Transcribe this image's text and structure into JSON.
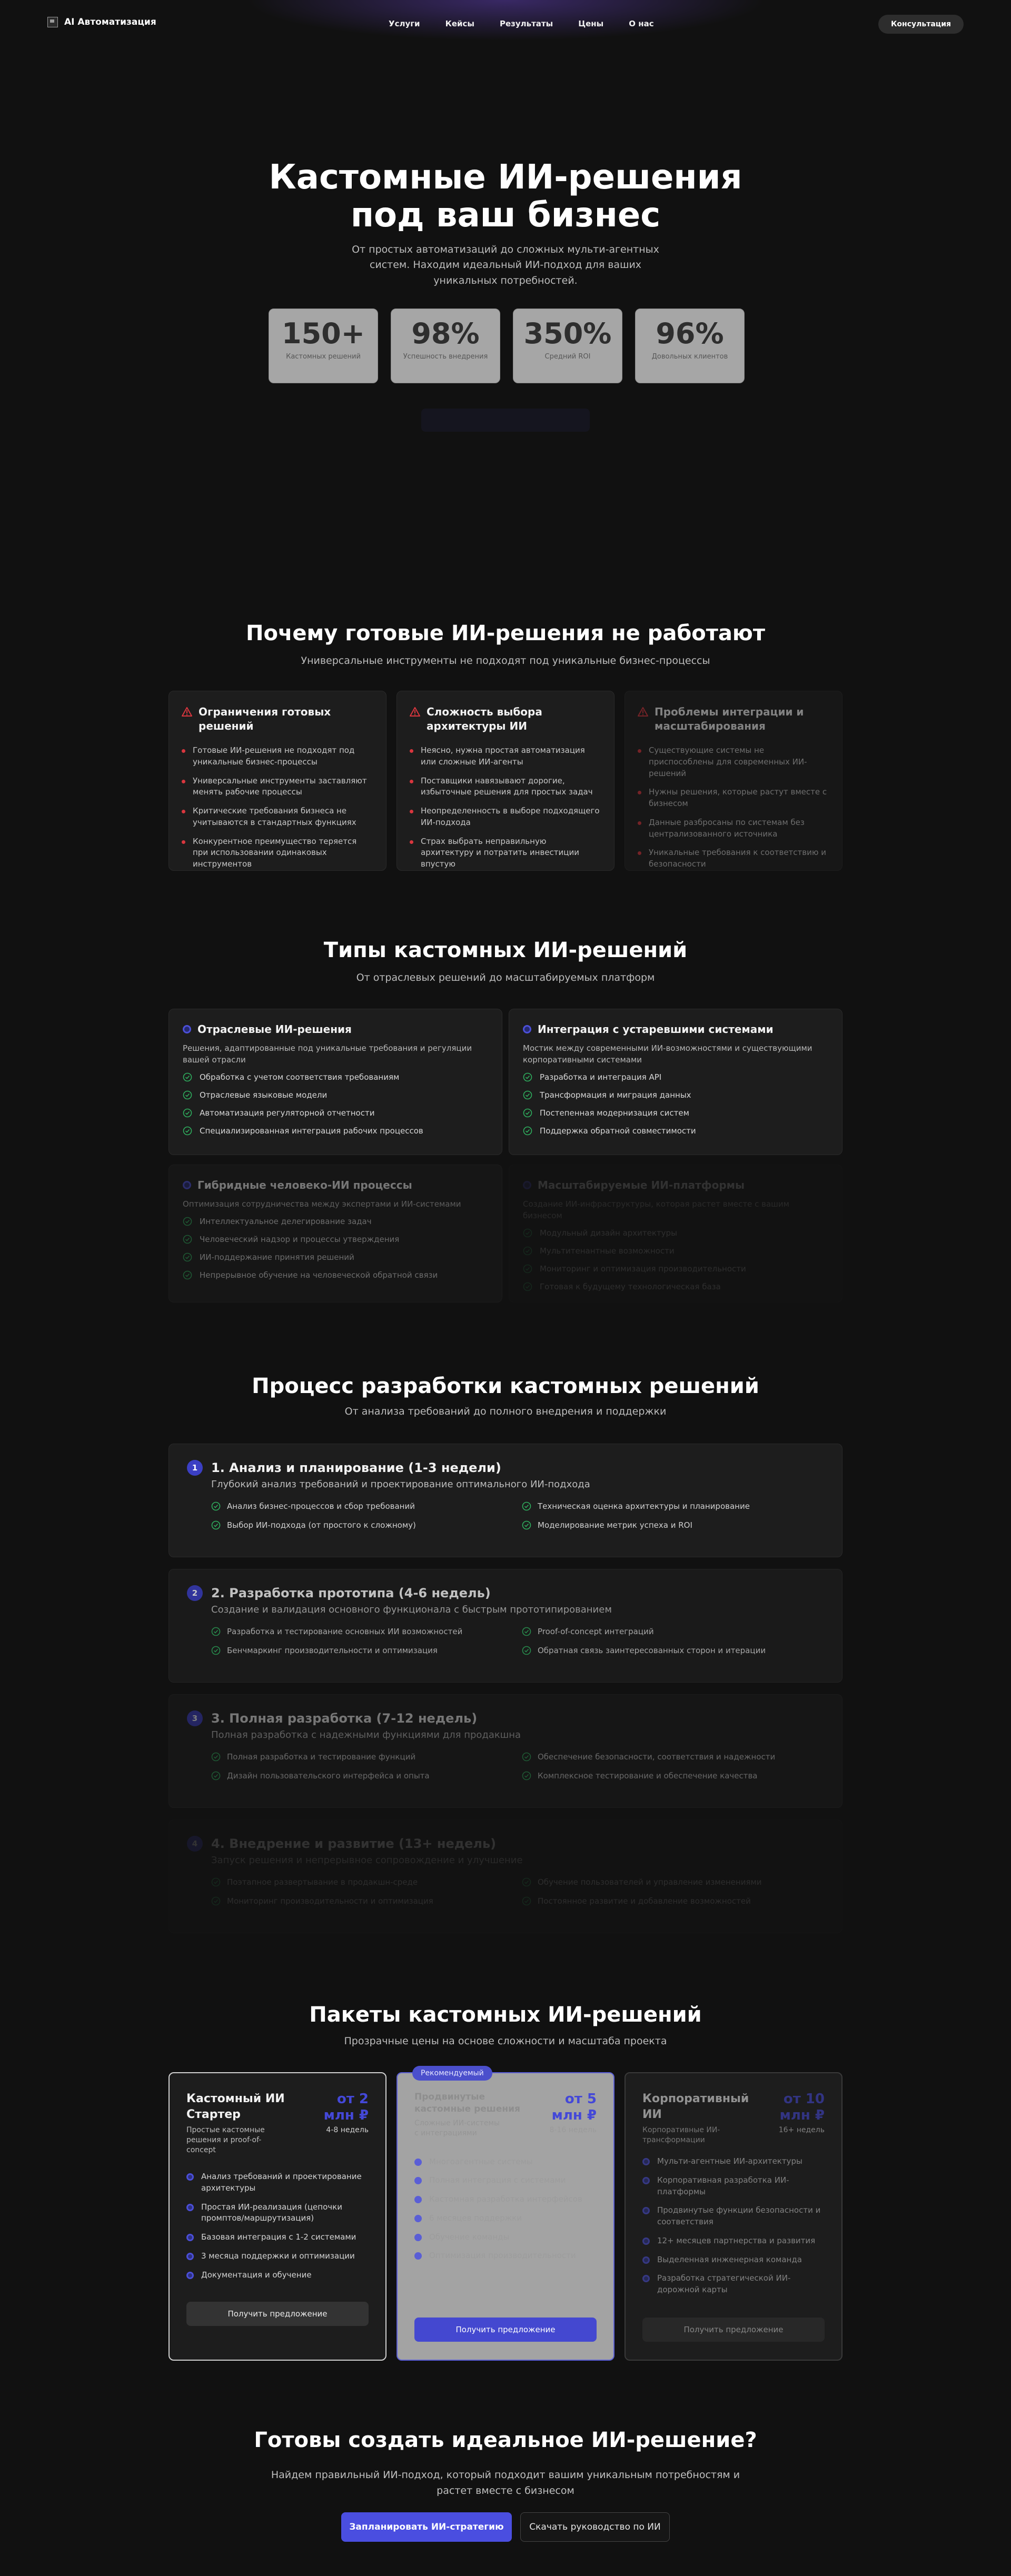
{
  "nav": {
    "logo_alt": "logo",
    "brand": "AI Автоматизация",
    "links": [
      "Услуги",
      "Кейсы",
      "Результаты",
      "Цены",
      "О нас"
    ],
    "cta": "Консультация"
  },
  "hero": {
    "title_line1": "Кастомные ИИ-решения",
    "title_line2": "под ваш бизнес",
    "subtitle": "От простых автоматизаций до сложных мульти-агентных систем. Находим идеальный ИИ-подход для ваших уникальных потребностей.",
    "stats": [
      {
        "value": "150+",
        "label": "Кастомных решений"
      },
      {
        "value": "98%",
        "label": "Успешность внедрения"
      },
      {
        "value": "350%",
        "label": "Средний ROI"
      },
      {
        "value": "96%",
        "label": "Довольных клиентов"
      }
    ]
  },
  "why": {
    "title": "Почему готовые ИИ-решения не работают",
    "subtitle": "Универсальные инструменты не подходят под уникальные бизнес-процессы",
    "cards": [
      {
        "title": "Ограничения готовых решений",
        "items": [
          "Готовые ИИ-решения не подходят под уникальные бизнес-процессы",
          "Универсальные инструменты заставляют менять рабочие процессы",
          "Критические требования бизнеса не учитываются в стандартных функциях",
          "Конкурентное преимущество теряется при использовании одинаковых инструментов"
        ]
      },
      {
        "title": "Сложность выбора архитектуры ИИ",
        "items": [
          "Неясно, нужна простая автоматизация или сложные ИИ-агенты",
          "Поставщики навязывают дорогие, избыточные решения для простых задач",
          "Неопределенность в выборе подходящего ИИ-подхода",
          "Страх выбрать неправильную архитектуру и потратить инвестиции впустую"
        ]
      },
      {
        "title": "Проблемы интеграции и масштабирования",
        "items": [
          "Существующие системы не приспособлены для современных ИИ-решений",
          "Нужны решения, которые растут вместе с бизнесом",
          "Данные разбросаны по системам без централизованного источника",
          "Уникальные требования к соответствию и безопасности"
        ]
      }
    ]
  },
  "types": {
    "title": "Типы кастомных ИИ-решений",
    "subtitle": "От отраслевых решений до масштабируемых платформ",
    "cards": [
      {
        "title": "Отраслевые ИИ-решения",
        "desc": "Решения, адаптированные под уникальные требования и регуляции вашей отрасли",
        "items": [
          "Обработка с учетом соответствия требованиям",
          "Отраслевые языковые модели",
          "Автоматизация регуляторной отчетности",
          "Специализированная интеграция рабочих процессов"
        ]
      },
      {
        "title": "Интеграция с устаревшими системами",
        "desc": "Мостик между современными ИИ-возможностями и существующими корпоративными системами",
        "items": [
          "Разработка и интеграция API",
          "Трансформация и миграция данных",
          "Постепенная модернизация систем",
          "Поддержка обратной совместимости"
        ]
      },
      {
        "title": "Гибридные человеко-ИИ процессы",
        "desc": "Оптимизация сотрудничества между экспертами и ИИ-системами",
        "items": [
          "Интеллектуальное делегирование задач",
          "Человеческий надзор и процессы утверждения",
          "ИИ-поддержание принятия решений",
          "Непрерывное обучение на человеческой обратной связи"
        ]
      },
      {
        "title": "Масштабируемые ИИ-платформы",
        "desc": "Создание ИИ-инфраструктуры, которая растет вместе с вашим бизнесом",
        "items": [
          "Модульный дизайн архитектуры",
          "Мультитенантные возможности",
          "Мониторинг и оптимизация производительности",
          "Готовая к будущему технологическая база"
        ]
      }
    ]
  },
  "process": {
    "title": "Процесс разработки кастомных решений",
    "subtitle": "От анализа требований до полного внедрения и поддержки",
    "steps": [
      {
        "num": "1",
        "title": "1. Анализ и планирование (1-3 недели)",
        "sub": "Глубокий анализ требований и проектирование оптимального ИИ-подхода",
        "items": [
          "Анализ бизнес-процессов и сбор требований",
          "Техническая оценка архитектуры и планирование",
          "Выбор ИИ-подхода (от простого к сложному)",
          "Моделирование метрик успеха и ROI"
        ]
      },
      {
        "num": "2",
        "title": "2. Разработка прототипа (4-6 недель)",
        "sub": "Создание и валидация основного функционала с быстрым прототипированием",
        "items": [
          "Разработка и тестирование основных ИИ возможностей",
          "Proof-of-concept интеграций",
          "Бенчмаркинг производительности и оптимизация",
          "Обратная связь заинтересованных сторон и итерации"
        ]
      },
      {
        "num": "3",
        "title": "3. Полная разработка (7-12 недель)",
        "sub": "Полная разработка с надежными функциями для продакшна",
        "items": [
          "Полная разработка и тестирование функций",
          "Обеспечение безопасности, соответствия и надежности",
          "Дизайн пользовательского интерфейса и опыта",
          "Комплексное тестирование и обеспечение качества"
        ]
      },
      {
        "num": "4",
        "title": "4. Внедрение и развитие (13+ недель)",
        "sub": "Запуск решения и непрерывное сопровождение и улучшение",
        "items": [
          "Поэтапное развертывание в продакшн-среде",
          "Обучение пользователей и управление изменениями",
          "Мониторинг производительности и оптимизация",
          "Постоянное развитие и добавление возможностей"
        ]
      }
    ]
  },
  "pricing": {
    "title": "Пакеты кастомных ИИ-решений",
    "subtitle": "Прозрачные цены на основе сложности и масштаба проекта",
    "plans": [
      {
        "name": "Кастомный ИИ Стартер",
        "desc": "Простые кастомные решения и proof-of-concept",
        "price": "от 2 млн ₽",
        "time": "4-8 недель",
        "items": [
          "Анализ требований и проектирование архитектуры",
          "Простая ИИ-реализация (цепочки промптов/маршрутизация)",
          "Базовая интеграция с 1-2 системами",
          "3 месяца поддержки и оптимизации",
          "Документация и обучение"
        ],
        "button": "Получить предложение"
      },
      {
        "name": "Продвинутые кастомные решения",
        "desc": "Сложные ИИ-системы с интеграциями",
        "price": "от 5 млн ₽",
        "time": "8-16 недель",
        "badge": "Рекомендуемый",
        "items": [
          "Многоагентные системы",
          "Полная интеграция с системами",
          "Кастомная разработка интерфейсов",
          "6 месяцев поддержки",
          "Обучение команды",
          "Оптимизация производительности"
        ],
        "button": "Получить предложение"
      },
      {
        "name": "Корпоративный ИИ",
        "desc": "Корпоративные ИИ-трансформации",
        "price": "от 10 млн ₽",
        "time": "16+ недель",
        "items": [
          "Мульти-агентные ИИ-архитектуры",
          "Корпоративная разработка ИИ-платформы",
          "Продвинутые функции безопасности и соответствия",
          "12+ месяцев партнерства и развития",
          "Выделенная инженерная команда",
          "Разработка стратегической ИИ-дорожной карты"
        ],
        "button": "Получить предложение"
      }
    ]
  },
  "cta": {
    "title": "Готовы создать идеальное ИИ-решение?",
    "subtitle": "Найдем правильный ИИ-подход, который подходит вашим уникальным потребностям и растет вместе с бизнесом",
    "primary": "Запланировать ИИ-стратегию",
    "secondary": "Скачать руководство по ИИ"
  },
  "colors": {
    "accent": "#4a4ee0",
    "danger": "#d9363e",
    "success": "#2fae5e",
    "background": "#111111"
  }
}
